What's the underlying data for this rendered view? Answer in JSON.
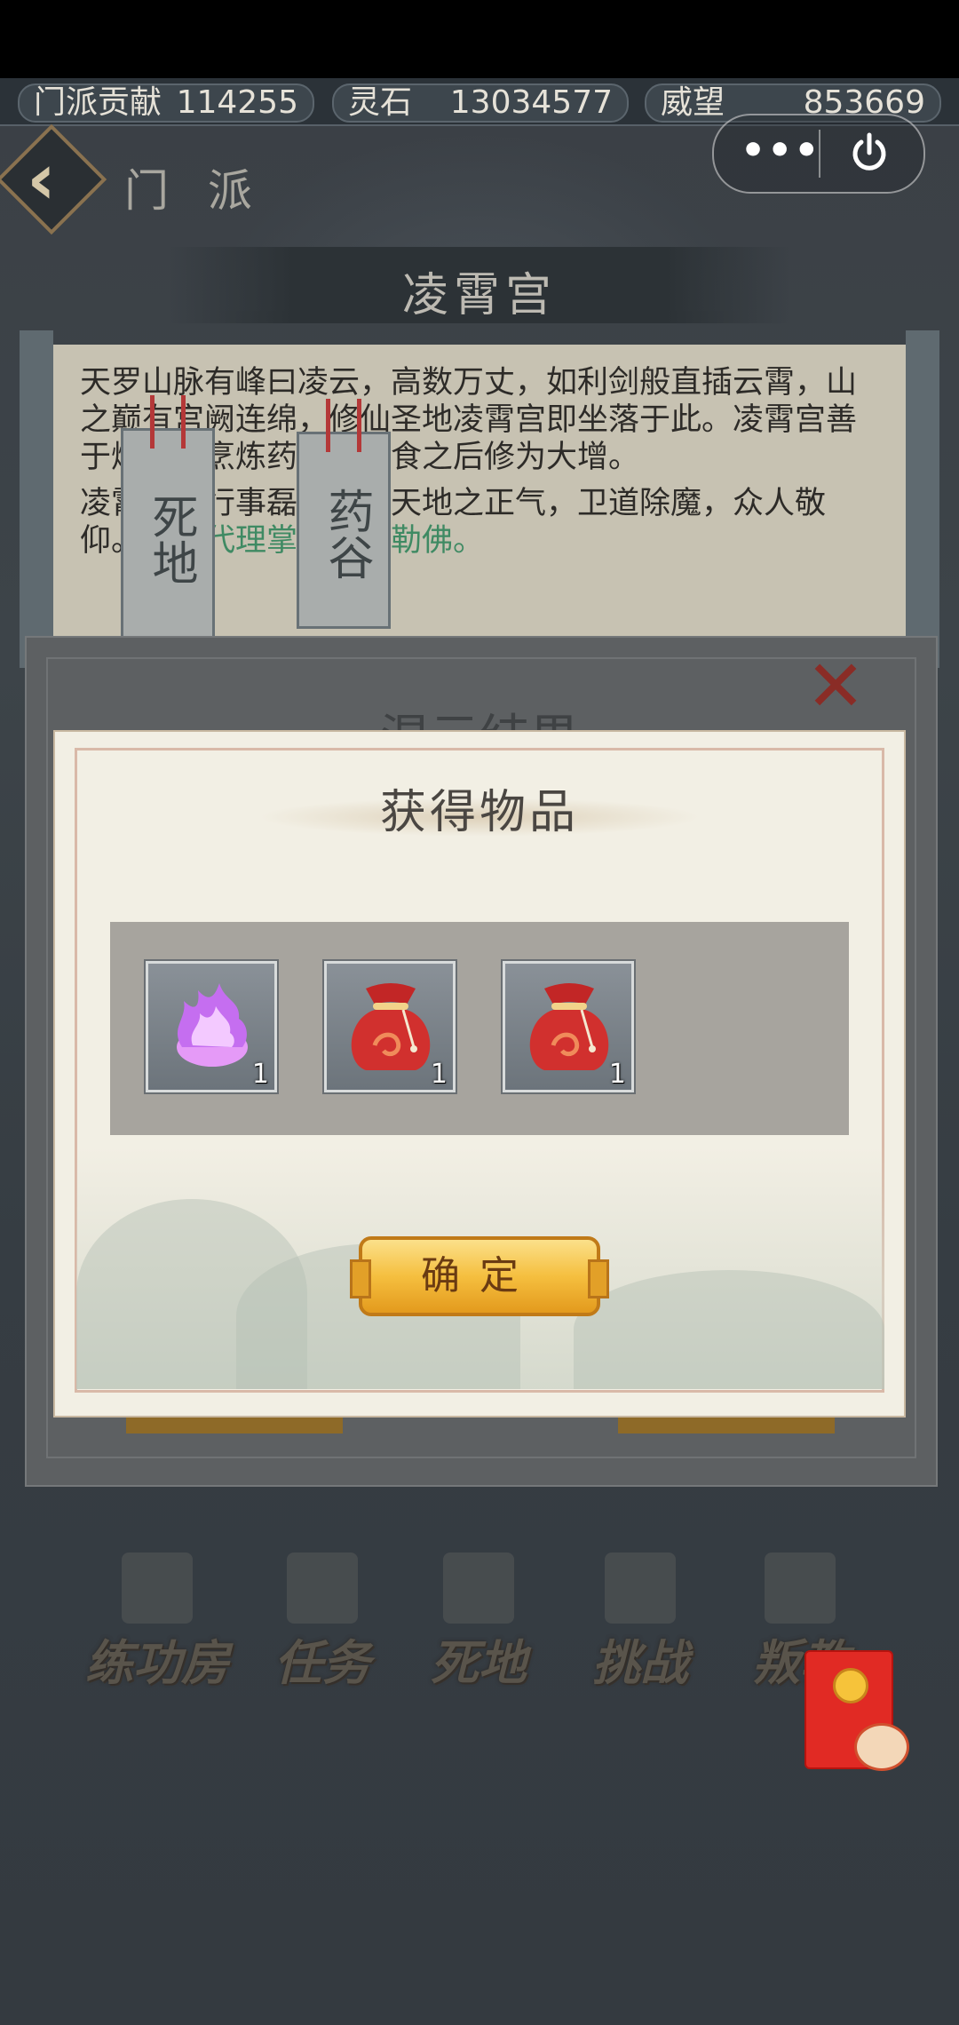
{
  "resources": [
    {
      "label": "门派贡献",
      "value": "114255"
    },
    {
      "label": "灵石",
      "value": "13034577"
    },
    {
      "label": "威望",
      "value": "853669"
    }
  ],
  "header": {
    "section_title": "门 派",
    "capsule_more": "•••"
  },
  "palace": {
    "title": "凌霄宫",
    "desc_p1": "天罗山脉有峰曰凌云，高数万丈，如利剑般直插云霄，山之巅有宫阙连绵，修仙圣地凌霄宫即坐落于此。凌霄宫善于炼丹，烹炼药草，服食之后修为大增。",
    "desc_p2_a": "凌霄宫人行事磊落，秉天地之正气，卫道除魔，众人敬仰。",
    "desc_p2_b": "目前代理掌门为弥勒佛。"
  },
  "tags": [
    {
      "label": "死地"
    },
    {
      "label": "药谷"
    }
  ],
  "underlying_panel": {
    "title": "混元结果"
  },
  "dialog": {
    "title": "获得物品",
    "items": [
      {
        "name": "purple-spirit-flame",
        "count": "1"
      },
      {
        "name": "red-lucky-bag",
        "count": "1"
      },
      {
        "name": "red-lucky-bag",
        "count": "1"
      }
    ],
    "confirm_label": "确定"
  },
  "bottom_nav": [
    {
      "label": "练功房",
      "icon": "pavilion-icon"
    },
    {
      "label": "任务",
      "icon": "scroll-icon"
    },
    {
      "label": "死地",
      "icon": "flame-icon"
    },
    {
      "label": "挑战",
      "icon": "gate-icon"
    },
    {
      "label": "叛教",
      "icon": "crossed-swords-icon"
    }
  ],
  "colors": {
    "accent_gold": "#f5bf3f",
    "close_red": "#8a2c26",
    "envelope_red": "#e12a24"
  }
}
